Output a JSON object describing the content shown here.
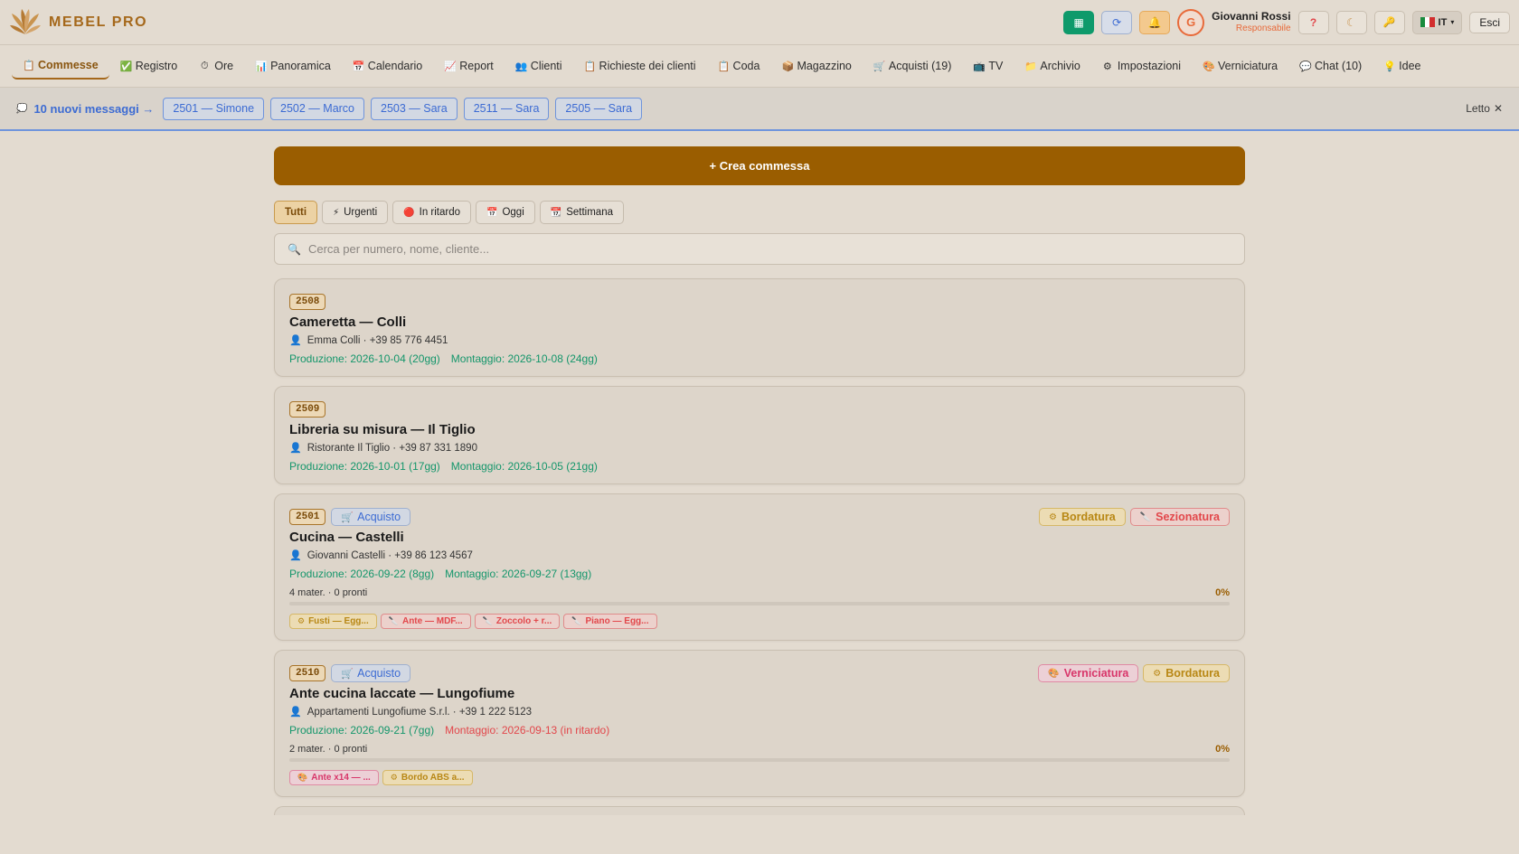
{
  "app": {
    "name": "MEBEL PRO",
    "brand_color": "#a5681b",
    "accent_color": "#9a5d00"
  },
  "topbar": {
    "buttons": [
      {
        "icon": "grid-icon",
        "glyph": "▦"
      },
      {
        "icon": "refresh-icon",
        "glyph": "⟳"
      },
      {
        "icon": "bell-icon",
        "glyph": "🔔"
      }
    ],
    "avatar_initial": "G",
    "user_name": "Giovanni Rossi",
    "user_role": "Responsabile",
    "help_glyph": "?",
    "moon_glyph": "☾",
    "key_glyph": "🔑",
    "lang": "IT",
    "logout": "Esci"
  },
  "nav": [
    {
      "label": "Commesse",
      "icon": "clipboard-icon",
      "glyph": "📋",
      "active": true
    },
    {
      "label": "Registro",
      "icon": "check-icon",
      "glyph": "✅"
    },
    {
      "label": "Ore",
      "icon": "clock-icon",
      "glyph": "⏱"
    },
    {
      "label": "Panoramica",
      "icon": "bar-chart-icon",
      "glyph": "📊"
    },
    {
      "label": "Calendario",
      "icon": "calendar-icon",
      "glyph": "📅"
    },
    {
      "label": "Report",
      "icon": "trend-icon",
      "glyph": "📈"
    },
    {
      "label": "Clienti",
      "icon": "people-icon",
      "glyph": "👥"
    },
    {
      "label": "Richieste dei clienti",
      "icon": "clipboard-icon",
      "glyph": "📋"
    },
    {
      "label": "Coda",
      "icon": "clipboard-icon",
      "glyph": "📋"
    },
    {
      "label": "Magazzino",
      "icon": "box-icon",
      "glyph": "📦"
    },
    {
      "label": "Acquisti (19)",
      "icon": "cart-icon",
      "glyph": "🛒"
    },
    {
      "label": "TV",
      "icon": "tv-icon",
      "glyph": "📺"
    },
    {
      "label": "Archivio",
      "icon": "folder-icon",
      "glyph": "📁"
    },
    {
      "label": "Impostazioni",
      "icon": "gear-icon",
      "glyph": "⚙"
    },
    {
      "label": "Verniciatura",
      "icon": "paint-icon",
      "glyph": "🎨"
    },
    {
      "label": "Chat (10)",
      "icon": "chat-icon",
      "glyph": "💬"
    },
    {
      "label": "Idee",
      "icon": "bulb-icon",
      "glyph": "💡"
    }
  ],
  "messages": {
    "link": "10 nuovi messaggi →",
    "chips": [
      "2501 — Simone",
      "2502 — Marco",
      "2503 — Sara",
      "2511 — Sara",
      "2505 — Sara"
    ],
    "read": "Letto",
    "close_glyph": "✕"
  },
  "main": {
    "create": "+ Crea commessa",
    "filters": [
      {
        "label": "Tutti",
        "glyph": "",
        "active": true
      },
      {
        "label": "Urgenti",
        "glyph": "⚡"
      },
      {
        "label": "In ritardo",
        "glyph": "🔴"
      },
      {
        "label": "Oggi",
        "glyph": "📅"
      },
      {
        "label": "Settimana",
        "glyph": "📆"
      }
    ],
    "search_placeholder": "Cerca per numero, nome, cliente..."
  },
  "cards": [
    {
      "num": "2508",
      "title": "Cameretta — Colli",
      "client": "Emma Colli · +39 85 776 4451",
      "prod": "Produzione: 2026-10-04 (20gg)",
      "mont": "Montaggio: 2026-10-08 (24gg)",
      "mont_late": false
    },
    {
      "num": "2509",
      "title": "Libreria su misura — Il Tiglio",
      "client": "Ristorante Il Tiglio · +39 87 331 1890",
      "prod": "Produzione: 2026-10-01 (17gg)",
      "mont": "Montaggio: 2026-10-05 (21gg)",
      "mont_late": false
    },
    {
      "num": "2501",
      "acquisto": "Acquisto",
      "stages": [
        {
          "label": "Bordatura",
          "kind": "bord",
          "glyph": "⚙"
        },
        {
          "label": "Sezionatura",
          "kind": "sez",
          "glyph": "🔪"
        }
      ],
      "title": "Cucina — Castelli",
      "client": "Giovanni Castelli · +39 86 123 4567",
      "prod": "Produzione: 2026-09-22 (8gg)",
      "mont": "Montaggio: 2026-09-27 (13gg)",
      "mont_late": false,
      "materials_summary": "4 mater. · 0 pronti",
      "progress": 0,
      "progress_label": "0%",
      "materials": [
        {
          "label": "Fusti — Egg...",
          "kind": "y",
          "glyph": "⚙"
        },
        {
          "label": "Ante — MDF...",
          "kind": "r",
          "glyph": "🔪"
        },
        {
          "label": "Zoccolo + r...",
          "kind": "r",
          "glyph": "🔪"
        },
        {
          "label": "Piano — Egg...",
          "kind": "r",
          "glyph": "🔪"
        }
      ]
    },
    {
      "num": "2510",
      "acquisto": "Acquisto",
      "stages": [
        {
          "label": "Verniciatura",
          "kind": "vern",
          "glyph": "🎨"
        },
        {
          "label": "Bordatura",
          "kind": "bord",
          "glyph": "⚙"
        }
      ],
      "title": "Ante cucina laccate — Lungofiume",
      "client": "Appartamenti Lungofiume S.r.l. · +39 1 222 5123",
      "prod": "Produzione: 2026-09-21 (7gg)",
      "mont": "Montaggio: 2026-09-13 (in ritardo)",
      "mont_late": true,
      "materials_summary": "2 mater. · 0 pronti",
      "progress": 0,
      "progress_label": "0%",
      "materials": [
        {
          "label": "Ante x14 — ...",
          "kind": "p",
          "glyph": "🎨"
        },
        {
          "label": "Bordo ABS a...",
          "kind": "y",
          "glyph": "⚙"
        }
      ]
    }
  ]
}
